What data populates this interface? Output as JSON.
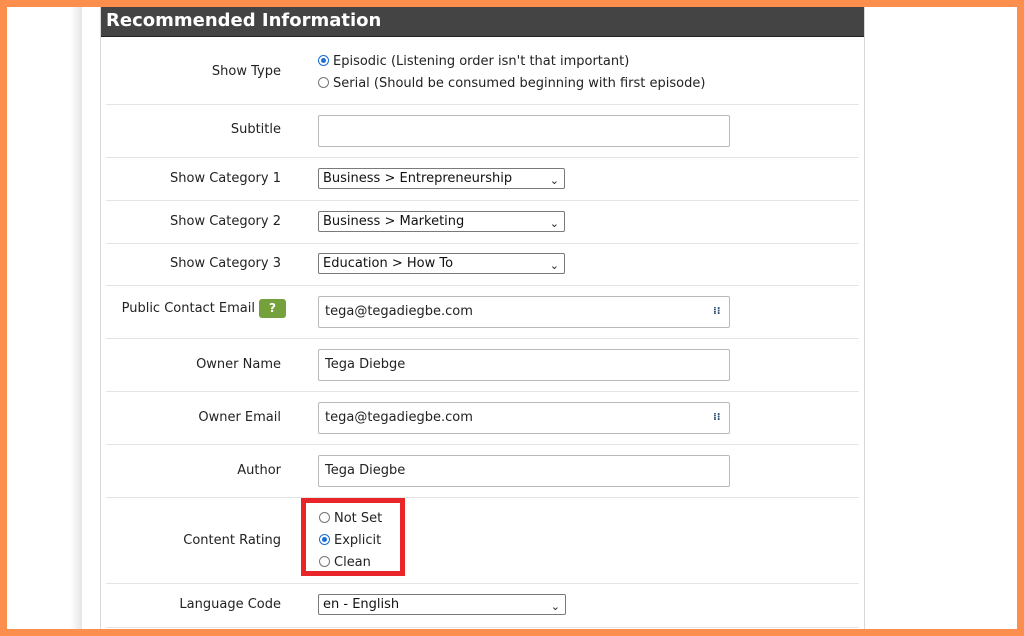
{
  "section": {
    "title": "Recommended Information"
  },
  "show_type": {
    "label": "Show Type",
    "options": [
      {
        "label": "Episodic (Listening order isn't that important)",
        "selected": true
      },
      {
        "label": "Serial (Should be consumed beginning with first episode)",
        "selected": false
      }
    ]
  },
  "subtitle": {
    "label": "Subtitle",
    "value": ""
  },
  "category1": {
    "label": "Show Category 1",
    "value": "Business > Entrepreneurship"
  },
  "category2": {
    "label": "Show Category 2",
    "value": "Business > Marketing"
  },
  "category3": {
    "label": "Show Category 3",
    "value": "Education > How To"
  },
  "public_email": {
    "label": "Public Contact Email",
    "help": "?",
    "value": "tega@tegadiegbe.com"
  },
  "owner_name": {
    "label": "Owner Name",
    "value": "Tega Diebge"
  },
  "owner_email": {
    "label": "Owner Email",
    "value": "tega@tegadiegbe.com"
  },
  "author": {
    "label": "Author",
    "value": "Tega Diegbe"
  },
  "content_rating": {
    "label": "Content Rating",
    "options": [
      {
        "label": "Not Set",
        "selected": false
      },
      {
        "label": "Explicit",
        "selected": true
      },
      {
        "label": "Clean",
        "selected": false
      }
    ]
  },
  "language": {
    "label": "Language Code",
    "value": "en - English"
  },
  "colors": {
    "frame": "#fc8e4e",
    "header": "#444444",
    "highlight": "#e8262a",
    "help": "#74a13b",
    "radio": "#1a6fd6"
  }
}
